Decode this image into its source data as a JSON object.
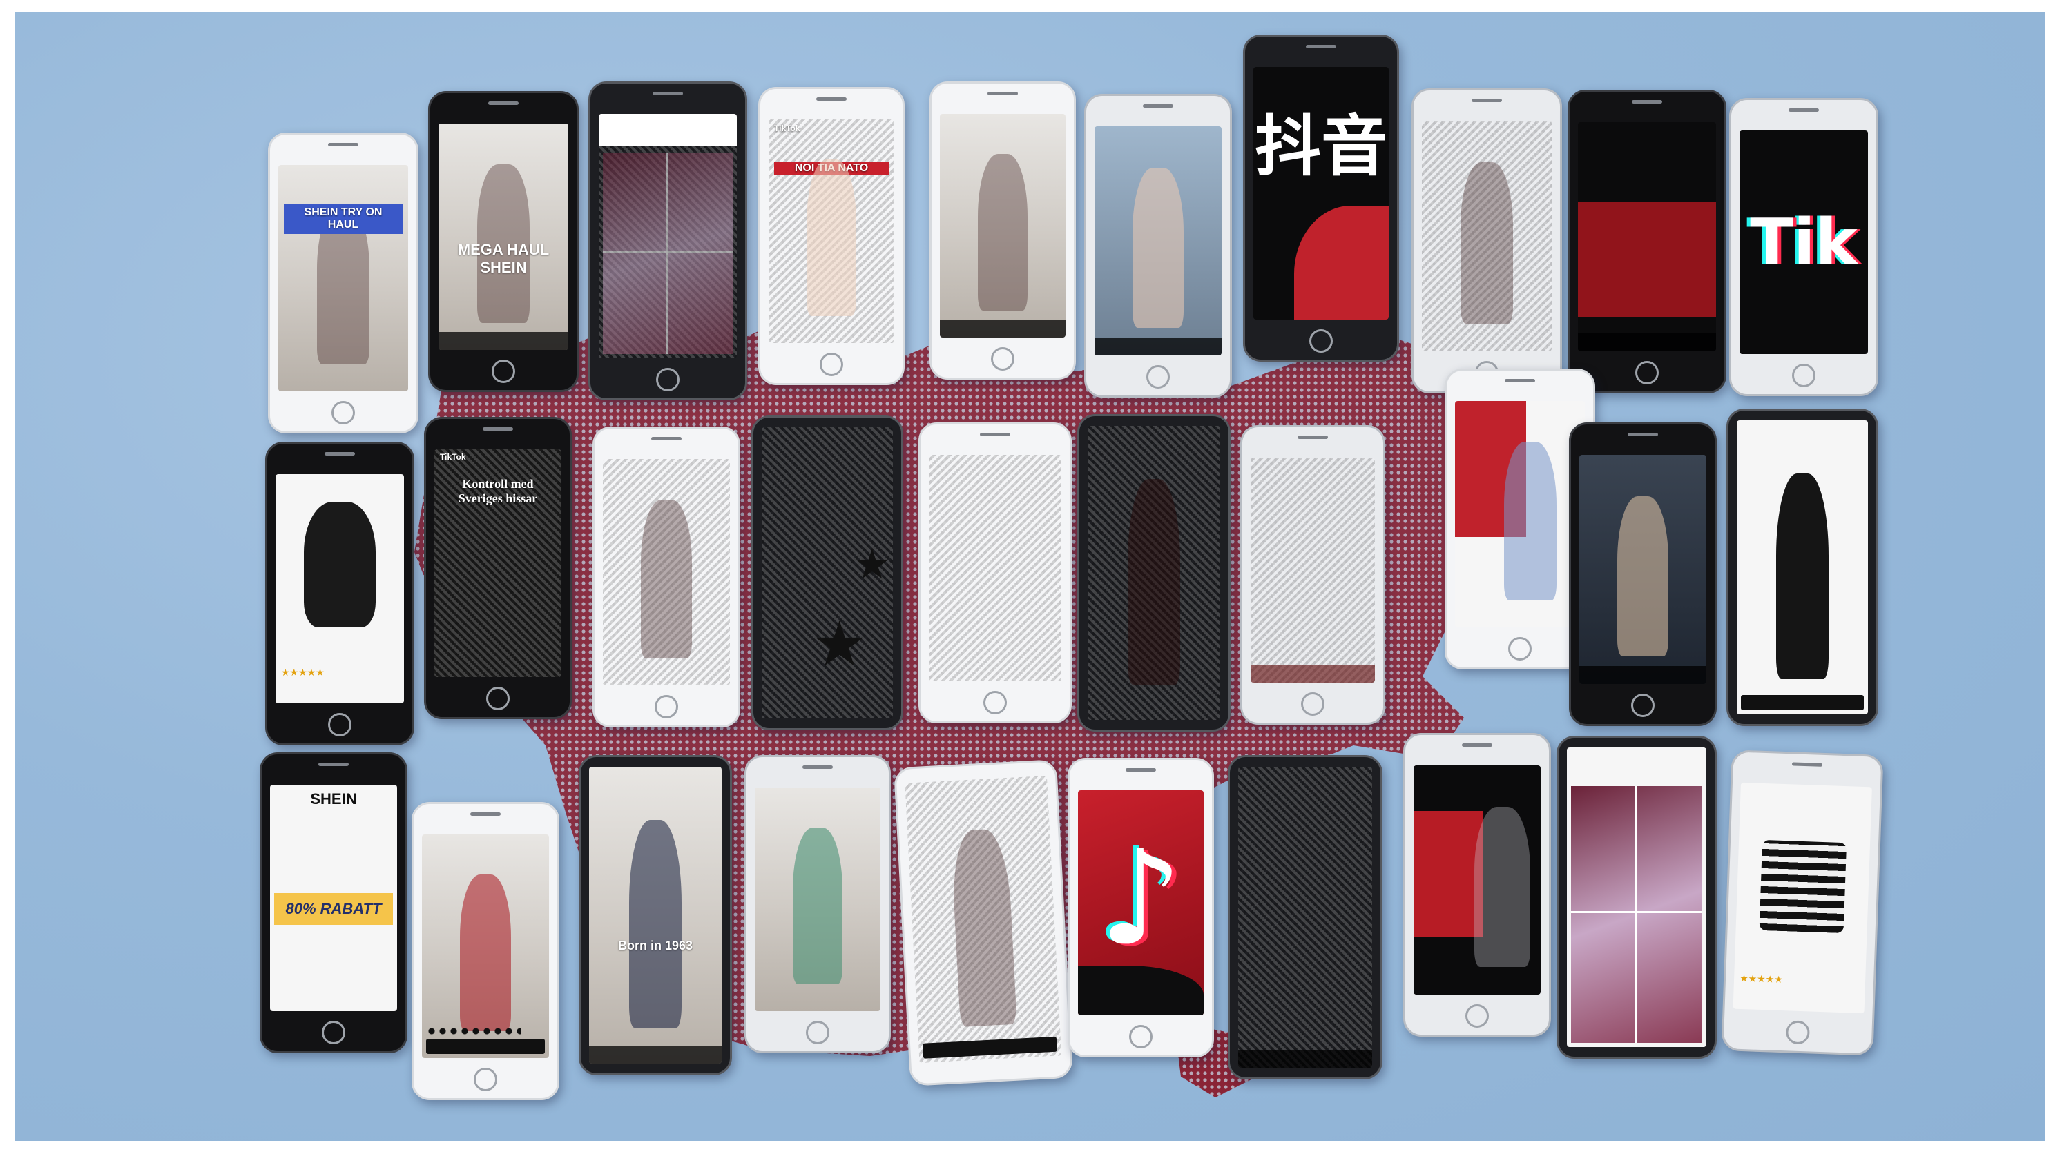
{
  "colors": {
    "background": "#9bbcdc",
    "map_red": "#b71c25",
    "map_pattern": "#7e1f2c",
    "accent_blue": "#3a58c8",
    "banner_yellow": "#f5c44a"
  },
  "phones": [
    {
      "id": "p1",
      "overlay": "SHEIN TRY ON HAUL"
    },
    {
      "id": "p2",
      "overlay": "MEGA HAUL SHEIN"
    },
    {
      "id": "p3",
      "overlay": ""
    },
    {
      "id": "p4",
      "brand": "TikTok",
      "overlay": "NOI TIA NATO"
    },
    {
      "id": "p5",
      "overlay": ""
    },
    {
      "id": "p6",
      "overlay": ""
    },
    {
      "id": "p7",
      "overlay": "抖音"
    },
    {
      "id": "p8",
      "overlay": ""
    },
    {
      "id": "p9",
      "overlay": ""
    },
    {
      "id": "p10",
      "overlay": "Tik"
    },
    {
      "id": "p11",
      "overlay": ""
    },
    {
      "id": "p12",
      "brand": "TikTok",
      "overlay": "Kontroll med Sveriges hissar"
    },
    {
      "id": "p13",
      "overlay": ""
    },
    {
      "id": "p14",
      "overlay": ""
    },
    {
      "id": "p15",
      "overlay": ""
    },
    {
      "id": "p16",
      "overlay": ""
    },
    {
      "id": "p17",
      "overlay": ""
    },
    {
      "id": "p18",
      "overlay": ""
    },
    {
      "id": "p19",
      "overlay": ""
    },
    {
      "id": "p20",
      "overlay": ""
    },
    {
      "id": "p21",
      "logo": "SHEIN",
      "banner": "80% RABATT"
    },
    {
      "id": "p22",
      "overlay": ""
    },
    {
      "id": "p23",
      "overlay": "Born in 1963"
    },
    {
      "id": "p24",
      "overlay": ""
    },
    {
      "id": "p25",
      "overlay": ""
    },
    {
      "id": "p26",
      "overlay": ""
    },
    {
      "id": "p27",
      "overlay": ""
    },
    {
      "id": "p28",
      "overlay": ""
    },
    {
      "id": "p29",
      "overlay": ""
    },
    {
      "id": "p30",
      "overlay": ""
    }
  ]
}
